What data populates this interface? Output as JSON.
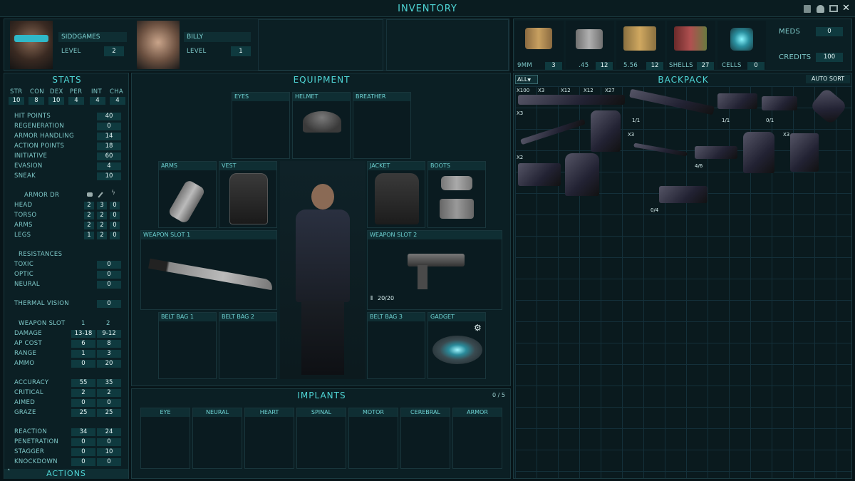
{
  "window": {
    "title": "INVENTORY"
  },
  "party": [
    {
      "name": "SIDDGAMES",
      "level_label": "LEVEL",
      "level": "2"
    },
    {
      "name": "BILLY",
      "level_label": "LEVEL",
      "level": "1"
    }
  ],
  "ammo": [
    {
      "label": "9MM",
      "count": "3"
    },
    {
      "label": ".45",
      "count": "12"
    },
    {
      "label": "5.56",
      "count": "12"
    },
    {
      "label": "SHELLS",
      "count": "27"
    },
    {
      "label": "CELLS",
      "count": "0"
    }
  ],
  "resources": {
    "meds_label": "MEDS",
    "meds": "0",
    "credits_label": "CREDITS",
    "credits": "100"
  },
  "stats": {
    "title": "STATS",
    "attributes": [
      {
        "label": "STR",
        "value": "10"
      },
      {
        "label": "CON",
        "value": "8"
      },
      {
        "label": "DEX",
        "value": "10"
      },
      {
        "label": "PER",
        "value": "4"
      },
      {
        "label": "INT",
        "value": "4"
      },
      {
        "label": "CHA",
        "value": "4"
      }
    ],
    "core": [
      {
        "label": "HIT POINTS",
        "value": "40"
      },
      {
        "label": "REGENERATION",
        "value": "0"
      },
      {
        "label": "ARMOR HANDLING",
        "value": "14"
      },
      {
        "label": "ACTION POINTS",
        "value": "18"
      },
      {
        "label": "INITIATIVE",
        "value": "60"
      },
      {
        "label": "EVASION",
        "value": "4"
      },
      {
        "label": "SNEAK",
        "value": "10"
      }
    ],
    "armor_dr_label": "ARMOR DR",
    "armor": [
      {
        "label": "HEAD",
        "v1": "2",
        "v2": "3",
        "v3": "0"
      },
      {
        "label": "TORSO",
        "v1": "2",
        "v2": "2",
        "v3": "0"
      },
      {
        "label": "ARMS",
        "v1": "2",
        "v2": "2",
        "v3": "0"
      },
      {
        "label": "LEGS",
        "v1": "1",
        "v2": "2",
        "v3": "0"
      }
    ],
    "resistances_label": "RESISTANCES",
    "resistances": [
      {
        "label": "TOXIC",
        "value": "0"
      },
      {
        "label": "OPTIC",
        "value": "0"
      },
      {
        "label": "NEURAL",
        "value": "0"
      }
    ],
    "thermal": {
      "label": "THERMAL VISION",
      "value": "0"
    },
    "weapon_slot_label": "WEAPON SLOT",
    "ws1": "1",
    "ws2": "2",
    "weapon": [
      {
        "label": "DAMAGE",
        "a": "13-18",
        "b": "9-12"
      },
      {
        "label": "AP COST",
        "a": "6",
        "b": "8"
      },
      {
        "label": "RANGE",
        "a": "1",
        "b": "3"
      },
      {
        "label": "AMMO",
        "a": "0",
        "b": "20"
      }
    ],
    "combat": [
      {
        "label": "ACCURACY",
        "a": "55",
        "b": "35"
      },
      {
        "label": "CRITICAL",
        "a": "2",
        "b": "2"
      },
      {
        "label": "AIMED",
        "a": "0",
        "b": "0"
      },
      {
        "label": "GRAZE",
        "a": "25",
        "b": "25"
      }
    ],
    "impact": [
      {
        "label": "REACTION",
        "a": "34",
        "b": "24"
      },
      {
        "label": "PENETRATION",
        "a": "0",
        "b": "0"
      },
      {
        "label": "STAGGER",
        "a": "0",
        "b": "10"
      },
      {
        "label": "KNOCKDOWN",
        "a": "0",
        "b": "0"
      }
    ],
    "actions_label": "ACTIONS"
  },
  "equipment": {
    "title": "EQUIPMENT",
    "slots": {
      "eyes": "EYES",
      "helmet": "HELMET",
      "breather": "BREATHER",
      "arms": "ARMS",
      "vest": "VEST",
      "jacket": "JACKET",
      "boots": "BOOTS",
      "weapon1": "WEAPON SLOT 1",
      "weapon2": "WEAPON SLOT 2",
      "belt1": "BELT BAG 1",
      "belt2": "BELT BAG 2",
      "belt3": "BELT BAG 3",
      "gadget": "GADGET"
    },
    "weapon2_ammo": "20/20"
  },
  "implants": {
    "title": "IMPLANTS",
    "count": "0 / 5",
    "slots": [
      "EYE",
      "NEURAL",
      "HEART",
      "SPINAL",
      "MOTOR",
      "CEREBRAL",
      "ARMOR"
    ]
  },
  "backpack": {
    "title": "BACKPACK",
    "filter": "ALL",
    "sort_label": "AUTO SORT",
    "stack_labels": {
      "a": "X100",
      "b": "X3",
      "c": "X12",
      "d": "X12",
      "e": "X27",
      "f": "X3",
      "g": "X3",
      "h": "X3",
      "i": "X2"
    },
    "ammo_labels": {
      "rifle": "1/1",
      "smg": "1/1",
      "pistol": "0/1",
      "pistol2": "4/6",
      "shotgun": "0/4"
    }
  },
  "colors": {
    "accent": "#4fd6d6",
    "panel": "#0b1f24",
    "value_bg": "#0f3a3f"
  }
}
